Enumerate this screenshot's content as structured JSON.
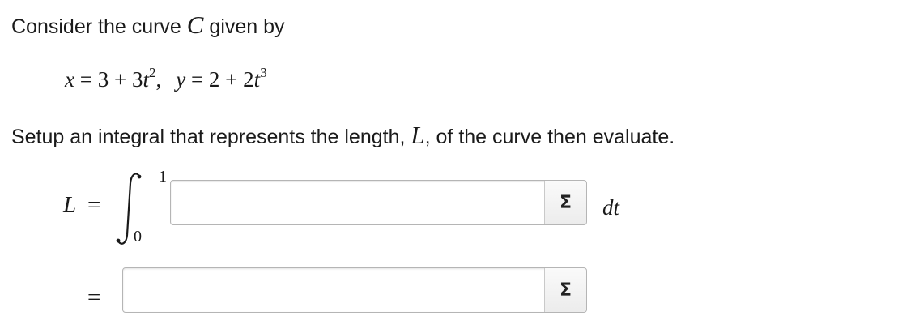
{
  "intro": {
    "text": "Consider the curve ",
    "symbol": "C",
    "tail": " given by"
  },
  "equations": {
    "x_var": "x",
    "x_rhs_a": " = 3 + 3",
    "t1": "t",
    "x_exp": "2",
    "comma": ",",
    "y_var": "y",
    "y_rhs_a": " = 2 + 2",
    "t2": "t",
    "y_exp": "3"
  },
  "setup": {
    "text": "Setup an integral that represents the length, ",
    "symbol": "L",
    "tail": ", of the curve then evaluate."
  },
  "integral": {
    "lhs_var": "L",
    "lhs_eq": "=",
    "upper": "1",
    "lower": "0",
    "differential": "dt",
    "input_value": "",
    "sigma": "Σ"
  },
  "result": {
    "eq": "=",
    "input_value": "",
    "sigma": "Σ"
  }
}
